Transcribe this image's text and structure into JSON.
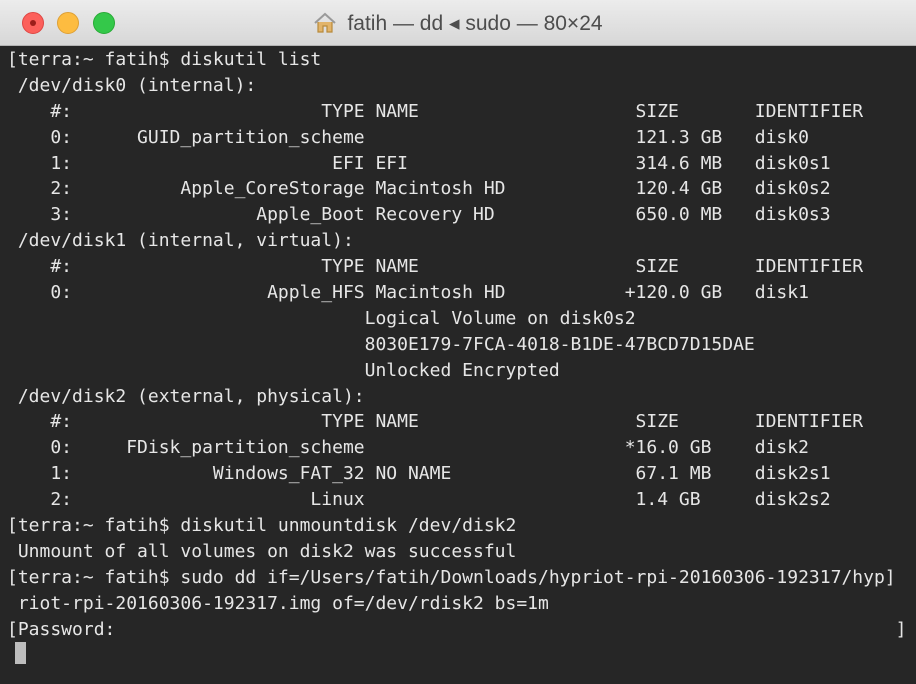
{
  "window": {
    "title": "fatih — dd ◂ sudo — 80×24",
    "colors": {
      "terminal_bg": "#262626",
      "terminal_fg": "#e6e6e6",
      "close": "#fc605b",
      "minimize": "#fdbc40",
      "zoom": "#34c84a"
    }
  },
  "terminal": {
    "lines": [
      "[terra:~ fatih$ diskutil list",
      " /dev/disk0 (internal):",
      "    #:                       TYPE NAME                    SIZE       IDENTIFIER",
      "    0:      GUID_partition_scheme                         121.3 GB   disk0",
      "    1:                        EFI EFI                     314.6 MB   disk0s1",
      "    2:          Apple_CoreStorage Macintosh HD            120.4 GB   disk0s2",
      "    3:                 Apple_Boot Recovery HD             650.0 MB   disk0s3",
      " /dev/disk1 (internal, virtual):",
      "    #:                       TYPE NAME                    SIZE       IDENTIFIER",
      "    0:                  Apple_HFS Macintosh HD           +120.0 GB   disk1",
      "                                 Logical Volume on disk0s2",
      "                                 8030E179-7FCA-4018-B1DE-47BCD7D15DAE",
      "                                 Unlocked Encrypted",
      " /dev/disk2 (external, physical):",
      "    #:                       TYPE NAME                    SIZE       IDENTIFIER",
      "    0:     FDisk_partition_scheme                        *16.0 GB    disk2",
      "    1:             Windows_FAT_32 NO NAME                 67.1 MB    disk2s1",
      "    2:                      Linux                         1.4 GB     disk2s2",
      "[terra:~ fatih$ diskutil unmountdisk /dev/disk2",
      " Unmount of all volumes on disk2 was successful",
      "[terra:~ fatih$ sudo dd if=/Users/fatih/Downloads/hypriot-rpi-20160306-192317/hyp]",
      " riot-rpi-20160306-192317.img of=/dev/rdisk2 bs=1m",
      "[Password:                                                                        ]"
    ]
  }
}
